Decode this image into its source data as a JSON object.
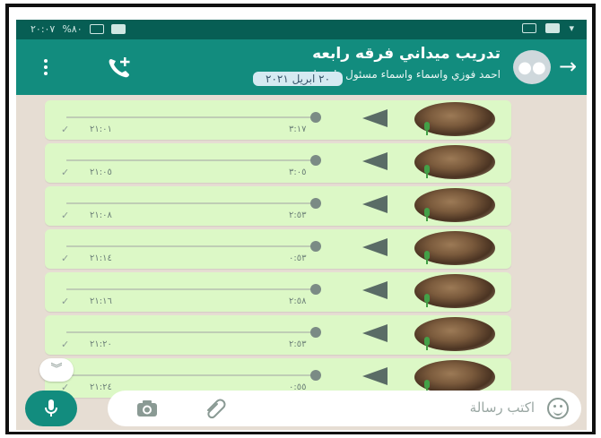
{
  "status_bar": {
    "time": "٢٠:٠٧",
    "battery_percent": "%٨٠"
  },
  "header": {
    "title": "تدريب ميداني فرقه رابعه",
    "subtitle": "احمد فوزي واسماء واسماء مسئول وايه وا..."
  },
  "date_chip": "٢٠ ابريل ٢٠٢١",
  "messages": [
    {
      "duration": "٣:١٧",
      "time": "٢١:٠١"
    },
    {
      "duration": "٣:٠٥",
      "time": "٢١:٠٥"
    },
    {
      "duration": "٢:٥٣",
      "time": "٢١:٠٨"
    },
    {
      "duration": "٠:٥٣",
      "time": "٢١:١٤"
    },
    {
      "duration": "٢:٥٨",
      "time": "٢١:١٦"
    },
    {
      "duration": "٢:٥٣",
      "time": "٢١:٢٠"
    },
    {
      "duration": "٠:٥٥",
      "time": "٢١:٢٤"
    }
  ],
  "input": {
    "placeholder": "اكتب رسالة"
  },
  "colors": {
    "header": "#128c7e",
    "status_bar": "#075e54",
    "bubble": "#dcf8c6",
    "wallpaper": "#e6ddd3"
  },
  "icons": {
    "back": "arrow-left-icon",
    "add_call": "add-call-icon",
    "menu": "more-vert-icon",
    "emoji": "emoji-icon",
    "attach": "paperclip-icon",
    "camera": "camera-icon",
    "mic": "mic-icon",
    "scroll": "scroll-down-icon"
  }
}
